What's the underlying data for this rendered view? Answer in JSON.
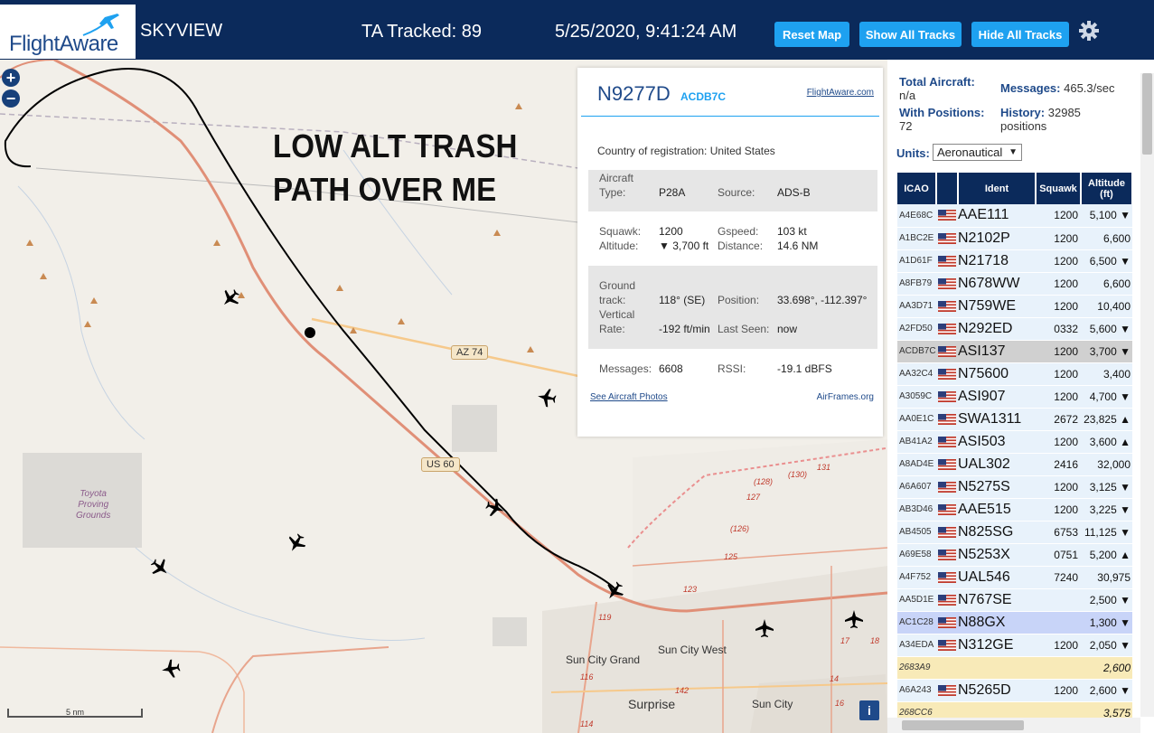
{
  "header": {
    "logo": "FlightAware",
    "app_title": "SKYVIEW",
    "ta_tracked": "TA Tracked: 89",
    "datetime": "5/25/2020, 9:41:24 AM",
    "buttons": {
      "reset": "Reset Map",
      "show_all": "Show All Tracks",
      "hide_all": "Hide All Tracks"
    },
    "settings_icon": "gear-icon",
    "colors": {
      "bar": "#0b2a5b",
      "button": "#1ea1f0"
    }
  },
  "map": {
    "zoom_in": "+",
    "zoom_out": "−",
    "annotation_line1": "LOW ALT TRASH",
    "annotation_line2": "PATH OVER ME",
    "labels": {
      "az74": "AZ 74",
      "us60": "US 60",
      "toyota": "Toyota\nProving\nGrounds",
      "sun_city_west": "Sun City West",
      "sun_city_grand": "Sun City Grand",
      "sun_city": "Sun City",
      "surprise": "Surprise",
      "r119": "119",
      "r123": "123",
      "r125": "125",
      "r126": "(126)",
      "r128": "(128)",
      "r127": "127",
      "r130": "(130)",
      "r131": "131",
      "r116": "116",
      "r114": "114",
      "r142": "142",
      "r17": "17",
      "r18": "18",
      "r14": "14",
      "r16": "16"
    },
    "scale": "5 nm",
    "info": "i"
  },
  "popup": {
    "ident": "N9277D",
    "icao": "ACDB7C",
    "fa_link": "FlightAware.com",
    "country_label": "Country of registration:",
    "country": "United States",
    "aircraft_type_label": "Aircraft\nType:",
    "aircraft_type": "P28A",
    "source_label": "Source:",
    "source": "ADS-B",
    "squawk_label": "Squawk:",
    "squawk": "1200",
    "gspeed_label": "Gspeed:",
    "gspeed": "103 kt",
    "altitude_label": "Altitude:",
    "altitude": "▼ 3,700 ft",
    "distance_label": "Distance:",
    "distance": "14.6 NM",
    "track_label": "Ground\ntrack:",
    "track": "118° (SE)",
    "position_label": "Position:",
    "position": "33.698°, -112.397°",
    "vrate_label": "Vertical\nRate:",
    "vrate": "-192 ft/min",
    "lastseen_label": "Last Seen:",
    "lastseen": "now",
    "messages_label": "Messages:",
    "messages": "6608",
    "rssi_label": "RSSI:",
    "rssi": "-19.1 dBFS",
    "photos_link": "See Aircraft Photos",
    "airframes_link": "AirFrames.org"
  },
  "panel": {
    "total_aircraft_label": "Total Aircraft:",
    "total_aircraft": "n/a",
    "messages_label": "Messages:",
    "messages": "465.3/sec",
    "with_positions_label": "With Positions:",
    "with_positions": "72",
    "history_label": "History:",
    "history": "32985",
    "history_unit": "positions",
    "units_label": "Units:",
    "units_value": "Aeronautical",
    "columns": [
      "ICAO",
      "",
      "Ident",
      "Squawk",
      "Altitude\n(ft)"
    ],
    "rows": [
      {
        "icao": "A4E68C",
        "ident": "AAE111",
        "squawk": "1200",
        "alt": "5,100 ▼",
        "style": ""
      },
      {
        "icao": "A1BC2E",
        "ident": "N2102P",
        "squawk": "1200",
        "alt": "6,600",
        "style": ""
      },
      {
        "icao": "A1D61F",
        "ident": "N21718",
        "squawk": "1200",
        "alt": "6,500 ▼",
        "style": ""
      },
      {
        "icao": "A8FB79",
        "ident": "N678WW",
        "squawk": "1200",
        "alt": "6,600",
        "style": ""
      },
      {
        "icao": "AA3D71",
        "ident": "N759WE",
        "squawk": "1200",
        "alt": "10,400",
        "style": ""
      },
      {
        "icao": "A2FD50",
        "ident": "N292ED",
        "squawk": "0332",
        "alt": "5,600 ▼",
        "style": ""
      },
      {
        "icao": "ACDB7C",
        "ident": "ASI137",
        "squawk": "1200",
        "alt": "3,700 ▼",
        "style": "sel"
      },
      {
        "icao": "AA32C4",
        "ident": "N75600",
        "squawk": "1200",
        "alt": "3,400",
        "style": ""
      },
      {
        "icao": "A3059C",
        "ident": "ASI907",
        "squawk": "1200",
        "alt": "4,700 ▼",
        "style": ""
      },
      {
        "icao": "AA0E1C",
        "ident": "SWA1311",
        "squawk": "2672",
        "alt": "23,825 ▲",
        "style": ""
      },
      {
        "icao": "AB41A2",
        "ident": "ASI503",
        "squawk": "1200",
        "alt": "3,600 ▲",
        "style": ""
      },
      {
        "icao": "A8AD4E",
        "ident": "UAL302",
        "squawk": "2416",
        "alt": "32,000",
        "style": ""
      },
      {
        "icao": "A6A607",
        "ident": "N5275S",
        "squawk": "1200",
        "alt": "3,125 ▼",
        "style": ""
      },
      {
        "icao": "AB3D46",
        "ident": "AAE515",
        "squawk": "1200",
        "alt": "3,225 ▼",
        "style": ""
      },
      {
        "icao": "AB4505",
        "ident": "N825SG",
        "squawk": "6753",
        "alt": "11,125 ▼",
        "style": ""
      },
      {
        "icao": "A69E58",
        "ident": "N5253X",
        "squawk": "0751",
        "alt": "5,200 ▲",
        "style": ""
      },
      {
        "icao": "A4F752",
        "ident": "UAL546",
        "squawk": "7240",
        "alt": "30,975",
        "style": ""
      },
      {
        "icao": "AA5D1E",
        "ident": "N767SE",
        "squawk": "",
        "alt": "2,500 ▼",
        "style": ""
      },
      {
        "icao": "AC1C28",
        "ident": "N88GX",
        "squawk": "",
        "alt": "1,300 ▼",
        "style": "hl"
      },
      {
        "icao": "A34EDA",
        "ident": "N312GE",
        "squawk": "1200",
        "alt": "2,050 ▼",
        "style": ""
      },
      {
        "icao": "2683A9",
        "ident": "",
        "squawk": "",
        "alt": "2,600",
        "style": "nopos"
      },
      {
        "icao": "A6A243",
        "ident": "N5265D",
        "squawk": "1200",
        "alt": "2,600 ▼",
        "style": ""
      },
      {
        "icao": "268CC6",
        "ident": "",
        "squawk": "",
        "alt": "3,575",
        "style": "nopos"
      }
    ]
  }
}
